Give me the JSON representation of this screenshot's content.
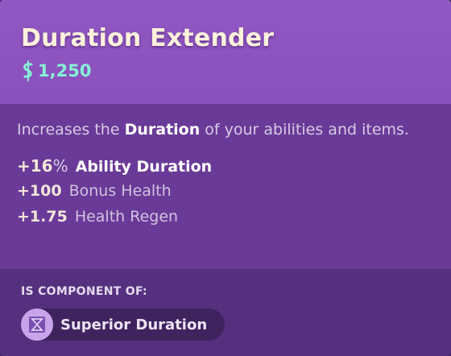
{
  "item": {
    "title": "Duration Extender",
    "price": "1,250"
  },
  "description": {
    "prefix": "Increases the ",
    "keyword": "Duration",
    "suffix": " of your abilities and items."
  },
  "stats": [
    {
      "value": "+16",
      "unit": "%",
      "label": "Ability Duration"
    },
    {
      "value": "+100",
      "label": "Bonus Health"
    },
    {
      "value": "+1.75",
      "label": "Health Regen"
    }
  ],
  "component_of": {
    "heading": "IS COMPONENT OF:",
    "items": [
      {
        "name": "Superior Duration",
        "icon": "superior-duration-icon"
      }
    ]
  },
  "colors": {
    "header_bg": "#9158c4",
    "body_bg": "#6a3a98",
    "footer_bg": "#55307f",
    "title": "#fff2dc",
    "price": "#86f1d6"
  },
  "icons": {
    "price": "souls-currency-icon"
  }
}
